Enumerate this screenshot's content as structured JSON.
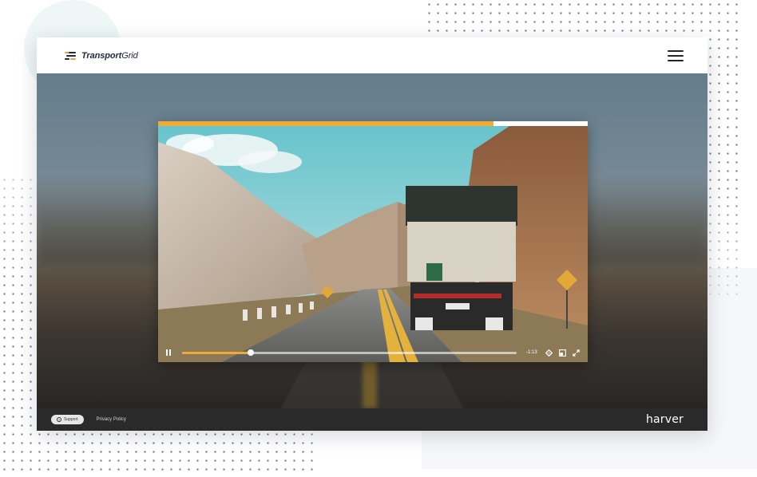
{
  "brand": {
    "name_bold": "Transport",
    "name_light": "Grid",
    "mark_colors": [
      "#f0a134",
      "#1d2a44",
      "#1d2a44",
      "#f0a134"
    ]
  },
  "header": {
    "menu_icon": "hamburger-icon"
  },
  "video": {
    "load_progress": 0.78,
    "played_fraction": 0.205,
    "time_remaining": "-1:13",
    "accent_color": "#efaa3a",
    "controls": [
      "pause-icon",
      "settings-icon",
      "pip-icon",
      "fullscreen-icon"
    ]
  },
  "footer": {
    "support_label": "Support",
    "privacy_label": "Privacy Policy",
    "logo_text": "harver"
  }
}
